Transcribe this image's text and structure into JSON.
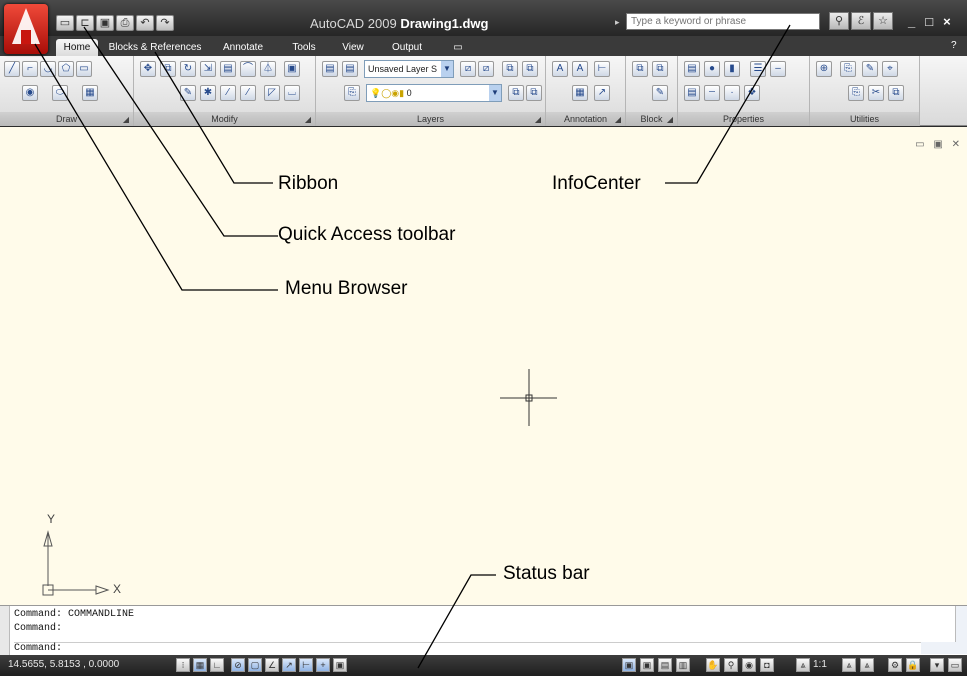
{
  "titlebar": {
    "app_name": "AutoCAD 2009",
    "document": "Drawing1.dwg",
    "search_placeholder": "Type a keyword or phrase",
    "qat_icons": [
      "new-icon",
      "open-icon",
      "save-icon",
      "plot-icon",
      "undo-icon",
      "redo-icon"
    ],
    "window_controls": [
      "_",
      "□",
      "×"
    ],
    "info_icons": [
      "search-icon",
      "subscription-icon",
      "favorites-icon"
    ]
  },
  "tabs": [
    {
      "label": "Home",
      "active": true
    },
    {
      "label": "Blocks & References",
      "active": false
    },
    {
      "label": "Annotate",
      "active": false
    },
    {
      "label": "Tools",
      "active": false
    },
    {
      "label": "View",
      "active": false
    },
    {
      "label": "Output",
      "active": false
    }
  ],
  "panels": {
    "draw": "Draw",
    "modify": "Modify",
    "layers": "Layers",
    "annotation": "Annotation",
    "block": "Block",
    "properties": "Properties",
    "utilities": "Utilities"
  },
  "layers": {
    "layer_state": "Unsaved Layer S",
    "current_layer": "0"
  },
  "callouts": {
    "ribbon": "Ribbon",
    "quick_access": "Quick Access toolbar",
    "menu_browser": "Menu Browser",
    "infocenter": "InfoCenter",
    "status_bar": "Status bar"
  },
  "ucs": {
    "y": "Y",
    "x": "X"
  },
  "command_window": {
    "lines": [
      "Command: COMMANDLINE",
      "Command:"
    ],
    "prompt": "Command:"
  },
  "statusbar": {
    "coordinates": "14.5655, 5.8153 , 0.0000",
    "annotation_scale": "1:1"
  }
}
